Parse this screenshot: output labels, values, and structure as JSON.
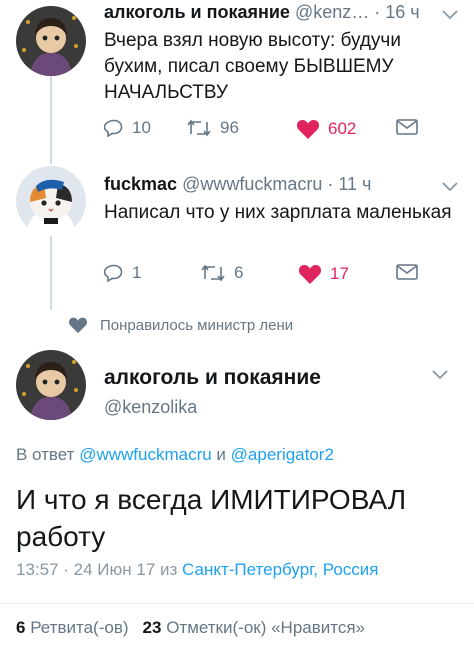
{
  "tweet1": {
    "name": "алкоголь и покаяние",
    "handle_time": "@kenz… · 16 ч",
    "text_lines": [
      "Вчера взял новую высоту: будучи",
      "бухим, писал своему БЫВШЕМУ",
      "НАЧАЛЬСТВУ"
    ],
    "replies": "10",
    "retweets": "96",
    "likes": "602",
    "liked": true
  },
  "tweet2": {
    "name": "fuckmac",
    "handle_time": "@wwwfuckmacru · 11 ч",
    "text": "Написал что у них зарплата маленькая",
    "replies": "1",
    "retweets": "6",
    "likes": "17",
    "liked": true
  },
  "liked_by": "Понравилось министр лени",
  "main": {
    "name": "алкоголь и покаяние",
    "handle": "@kenzolika",
    "reply_prefix": "В ответ",
    "reply_user1": "@wwwfuckmacru",
    "reply_and": "и",
    "reply_user2": "@aperigator2",
    "text_lines": [
      "И что я всегда ИМИТИРОВАЛ",
      "работу"
    ],
    "time": "13:57 · 24 Июн 17 из",
    "location": "Санкт-Петербург, Россия",
    "retweets_count": "6",
    "retweets_label": "Ретвита(-ов)",
    "likes_count": "23",
    "likes_label": "Отметки(-ок) «Нравится»"
  },
  "colors": {
    "accent": "#1da1f2",
    "like": "#e0245e",
    "muted": "#657786"
  }
}
